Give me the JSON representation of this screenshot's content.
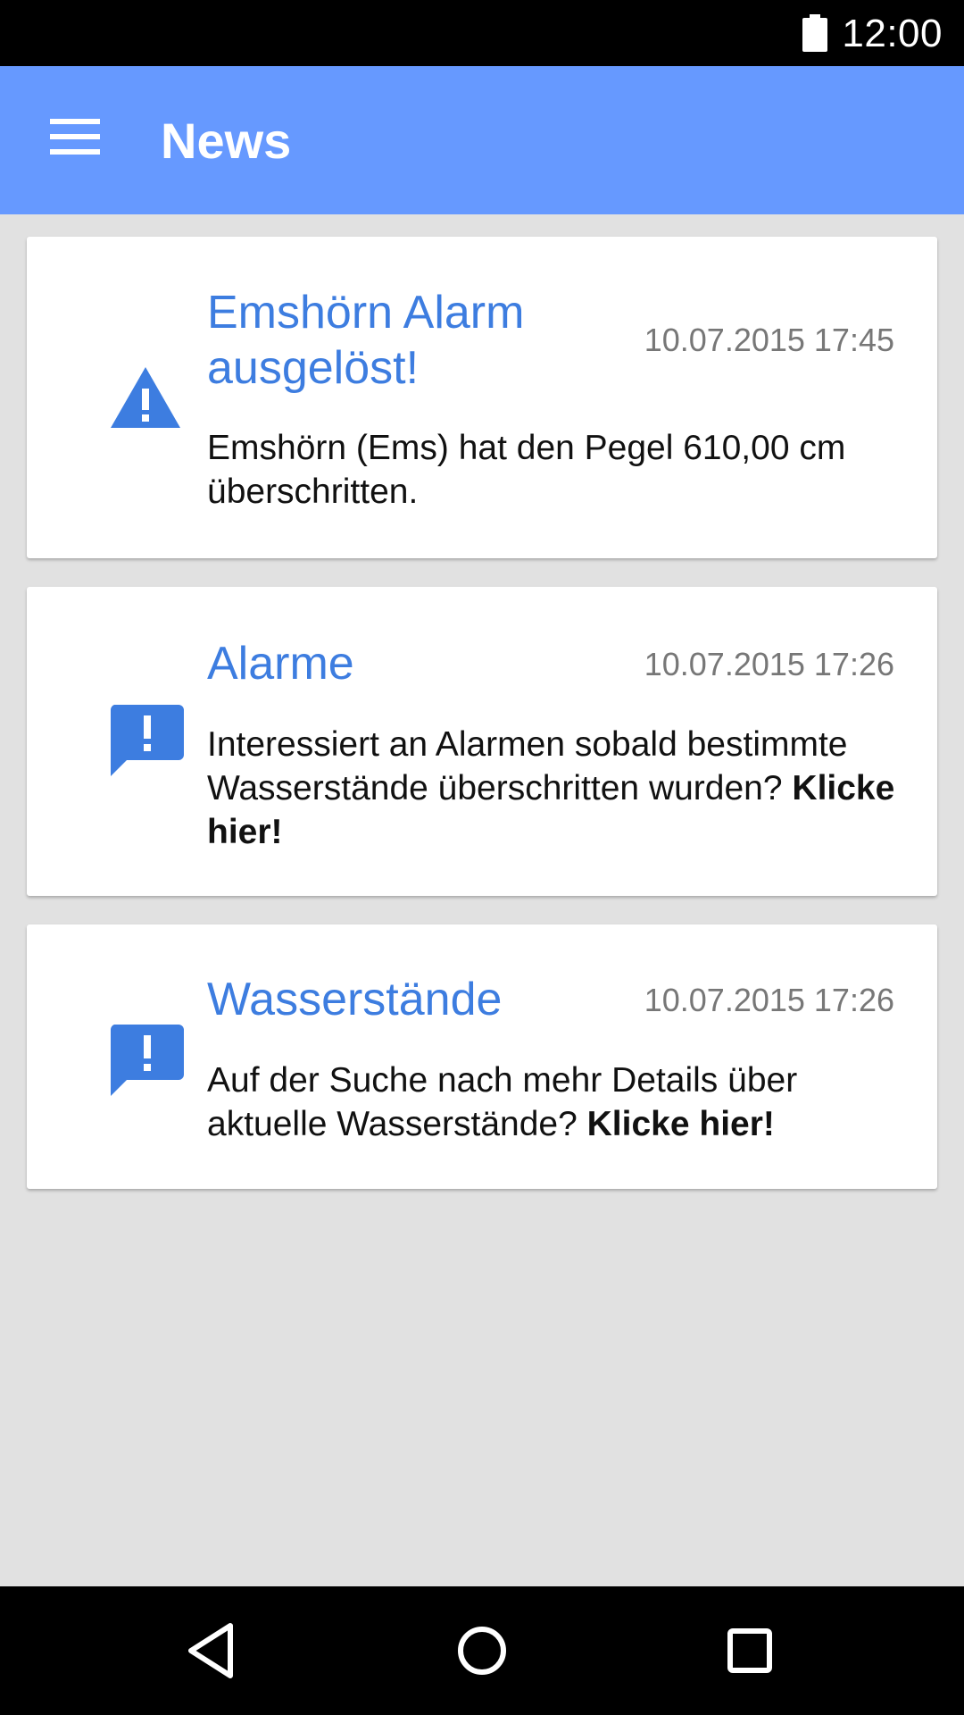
{
  "status_bar": {
    "time": "12:00",
    "icons": [
      "battery-icon"
    ]
  },
  "app_bar": {
    "title": "News",
    "menu_icon": "menu-icon"
  },
  "colors": {
    "app_bar": "#6699ff",
    "accent_text": "#3d7de0",
    "icon": "#3d7de0",
    "background": "#e1e1e1"
  },
  "news": [
    {
      "icon": "warning-icon",
      "title": "Emshörn Alarm ausgelöst!",
      "date": "10.07.2015 17:45",
      "body": "Emshörn (Ems) hat den Pegel 610,00 cm überschritten.",
      "link": ""
    },
    {
      "icon": "feedback-icon",
      "title": "Alarme",
      "date": "10.07.2015 17:26",
      "body": "Interessiert an Alarmen sobald bestimmte Wasserstände überschritten wurden?",
      "link": "Klicke hier!"
    },
    {
      "icon": "feedback-icon",
      "title": "Wasserstände",
      "date": "10.07.2015 17:26",
      "body": "Auf der Suche nach mehr Details über aktuelle Wasserstände?",
      "link": "Klicke hier!"
    }
  ],
  "nav_bar": {
    "buttons": [
      "back-icon",
      "home-icon",
      "recents-icon"
    ]
  }
}
